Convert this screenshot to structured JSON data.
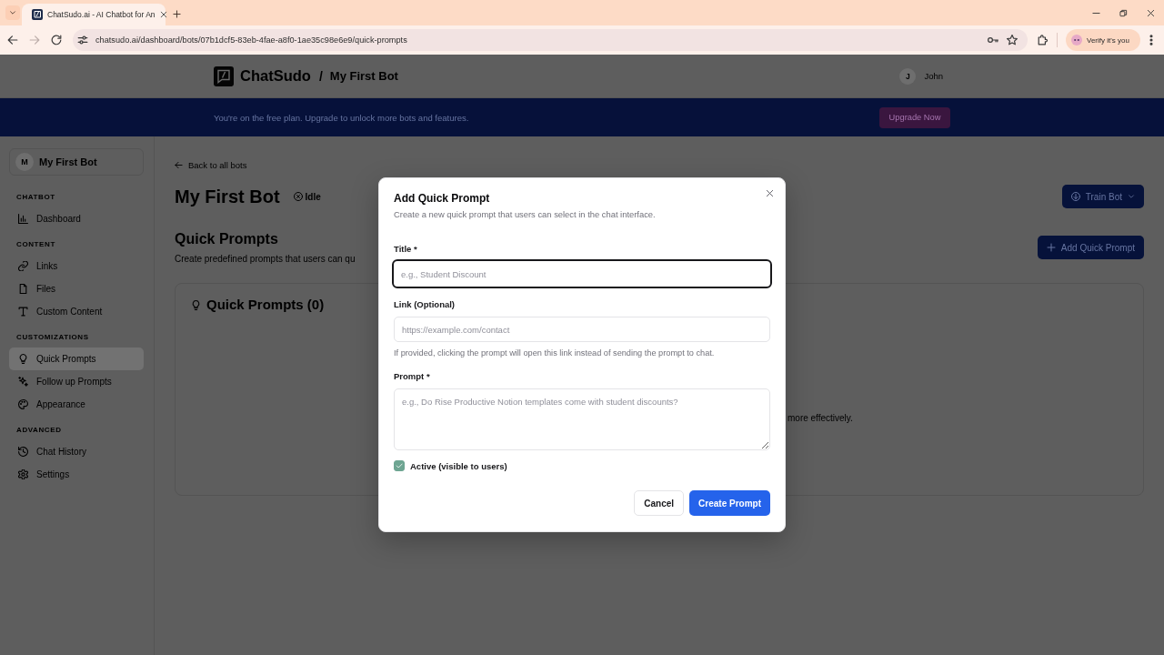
{
  "browser": {
    "tab": {
      "title": "ChatSudo.ai - AI Chatbot for An"
    },
    "forward_disabled": true,
    "address": "chatsudo.ai/dashboard/bots/07b1dcf5-83eb-4fae-a8f0-1ae35c98e6e9/quick-prompts",
    "profile_button": "Verify it's you"
  },
  "header": {
    "brand": "ChatSudo",
    "separator": "/",
    "bot_name": "My First Bot",
    "user": {
      "initial": "J",
      "name": "John"
    }
  },
  "banner": {
    "message": "You're on the free plan. Upgrade to unlock more bots and features.",
    "button": "Upgrade Now"
  },
  "sidebar": {
    "bot": {
      "initial": "M",
      "name": "My First Bot"
    },
    "sections": [
      {
        "heading": "CHATBOT",
        "items": [
          {
            "label": "Dashboard",
            "selected": false
          }
        ]
      },
      {
        "heading": "CONTENT",
        "items": [
          {
            "label": "Links",
            "selected": false
          },
          {
            "label": "Files",
            "selected": false
          },
          {
            "label": "Custom Content",
            "selected": false
          }
        ]
      },
      {
        "heading": "CUSTOMIZATIONS",
        "items": [
          {
            "label": "Quick Prompts",
            "selected": true
          },
          {
            "label": "Follow up Prompts",
            "selected": false
          },
          {
            "label": "Appearance",
            "selected": false
          }
        ]
      },
      {
        "heading": "ADVANCED",
        "items": [
          {
            "label": "Chat History",
            "selected": false
          },
          {
            "label": "Settings",
            "selected": false
          }
        ]
      }
    ]
  },
  "main": {
    "back_link": "Back to all bots",
    "title": "My First Bot",
    "status": "Idle",
    "train_button": "Train Bot",
    "section": {
      "title": "Quick Prompts",
      "subtitle": "Create predefined prompts that users can qu",
      "add_button": "Add Quick Prompt"
    },
    "card": {
      "title": "Quick Prompts (0)",
      "empty_text": "more effectively."
    }
  },
  "dialog": {
    "title": "Add Quick Prompt",
    "subtitle": "Create a new quick prompt that users can select in the chat interface.",
    "fields": [
      {
        "kind": "input",
        "label": "Title *",
        "placeholder": "e.g., Student Discount",
        "focused": true
      },
      {
        "kind": "input",
        "label": "Link (Optional)",
        "placeholder": "https://example.com/contact",
        "help": "If provided, clicking the prompt will open this link instead of sending the prompt to chat.",
        "focused": false
      },
      {
        "kind": "textarea",
        "label": "Prompt *",
        "placeholder": "e.g., Do Rise Productive Notion templates come with student discounts?",
        "focused": false
      }
    ],
    "checkbox": {
      "label": "Active (visible to users)",
      "checked": true
    },
    "buttons": [
      {
        "kind": "secondary",
        "label": "Cancel"
      },
      {
        "kind": "primary",
        "label": "Create Prompt"
      }
    ]
  }
}
